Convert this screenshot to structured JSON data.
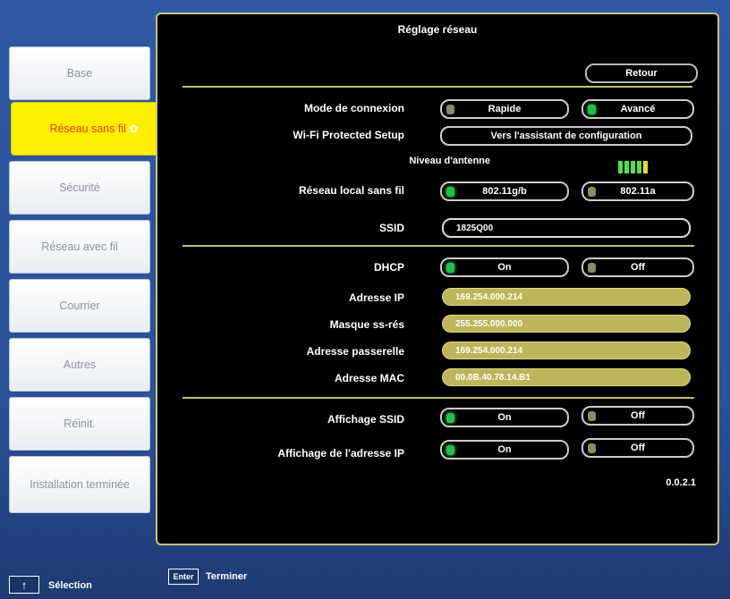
{
  "sidebar": {
    "items": [
      {
        "label": "Base"
      },
      {
        "label": "Réseau sans fil"
      },
      {
        "label": "Sécurité"
      },
      {
        "label": "Réseau avec fil"
      },
      {
        "label": "Courrier"
      },
      {
        "label": "Autres"
      },
      {
        "label": "Réinit."
      },
      {
        "label": "Installation terminée"
      }
    ],
    "active_index": 1
  },
  "panel": {
    "title": "Réglage réseau",
    "back_label": "Retour",
    "connection_mode": {
      "label": "Mode de connexion",
      "options": [
        "Rapide",
        "Avancé"
      ],
      "selected": "Avancé"
    },
    "wps": {
      "label": "Wi-Fi Protected Setup",
      "button": "Vers l'assistant de configuration"
    },
    "antenna": {
      "label": "Niveau d'antenne",
      "level": 5
    },
    "wlan": {
      "label": "Réseau local sans fil",
      "options": [
        "802.11g/b",
        "802.11a"
      ],
      "selected": "802.11g/b"
    },
    "ssid": {
      "label": "SSID",
      "value": "1825Q00"
    },
    "dhcp": {
      "label": "DHCP",
      "options": [
        "On",
        "Off"
      ],
      "selected": "On"
    },
    "ip": {
      "label": "Adresse IP",
      "value": "169.254.000.214"
    },
    "mask": {
      "label": "Masque ss-rés",
      "value": "255.255.000.000"
    },
    "gateway": {
      "label": "Adresse passerelle",
      "value": "169.254.000.214"
    },
    "mac": {
      "label": "Adresse MAC",
      "value": "00.0B.40.78.14.B1"
    },
    "ssid_display": {
      "label": "Affichage SSID",
      "options": [
        "On",
        "Off"
      ],
      "selected": "On"
    },
    "ip_display": {
      "label": "Affichage de l'adresse IP",
      "options": [
        "On",
        "Off"
      ],
      "selected": "On"
    },
    "version": "0.0.2.1"
  },
  "footer": {
    "select_key": "↑",
    "select_label": "Sélection",
    "enter_key": "Enter",
    "enter_label": "Terminer"
  },
  "colors": {
    "active_tab": "#ffef00",
    "field_fill": "#bdb55a",
    "panel_border": "#c7c27a"
  }
}
